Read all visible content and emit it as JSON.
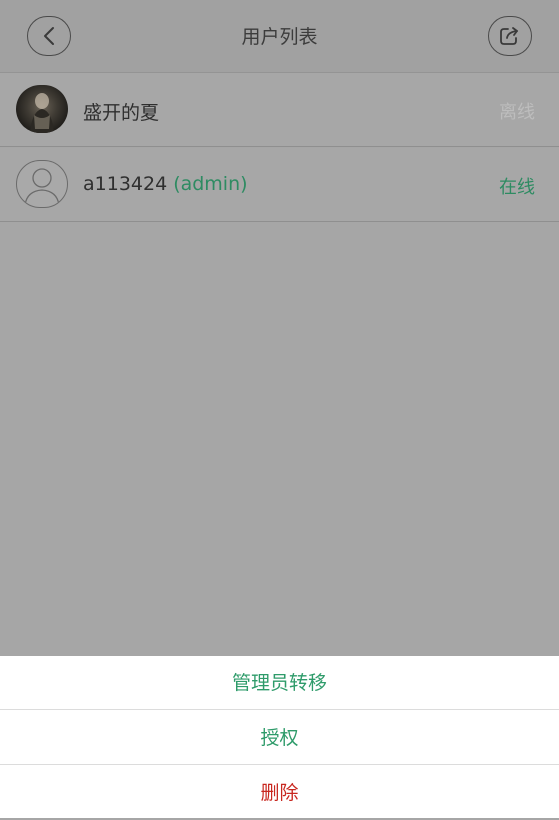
{
  "header": {
    "title": "用户列表",
    "back_icon": "chevron-left-icon",
    "share_icon": "share-export-icon"
  },
  "users": [
    {
      "name": "盛开的夏",
      "role": "",
      "status": "离线",
      "avatar": "photo-avatar"
    },
    {
      "name": "a113424",
      "role": "(admin)",
      "status": "在线",
      "avatar": "default-user-icon"
    }
  ],
  "action_sheet": {
    "items": [
      "管理员转移",
      "授权",
      "删除"
    ]
  },
  "colors": {
    "accent": "#2e9b6a",
    "danger": "#c8271f",
    "offline": "#bdbdbd"
  }
}
